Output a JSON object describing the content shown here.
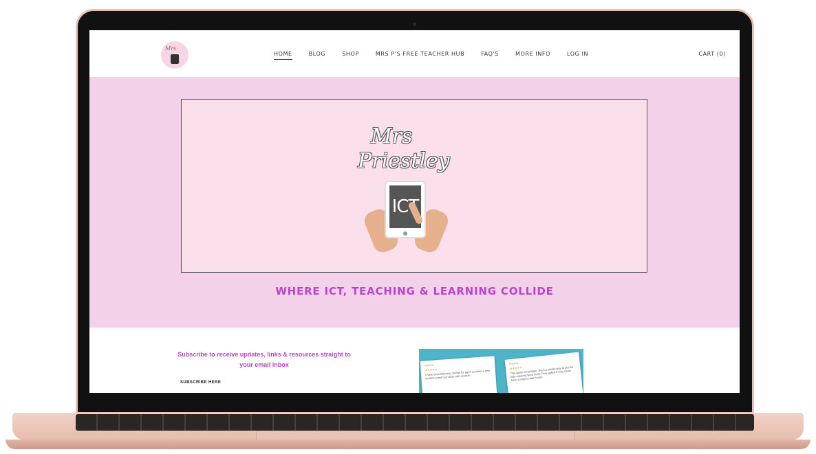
{
  "nav": {
    "items": [
      {
        "label": "HOME",
        "active": true
      },
      {
        "label": "BLOG",
        "active": false
      },
      {
        "label": "SHOP",
        "active": false
      },
      {
        "label": "MRS P'S FREE TEACHER HUB",
        "active": false
      },
      {
        "label": "FAQ'S",
        "active": false
      },
      {
        "label": "MORE INFO",
        "active": false
      },
      {
        "label": "LOG IN",
        "active": false
      }
    ],
    "cart": "CART (0)"
  },
  "hero": {
    "brand_line1": "Mrs",
    "brand_line2": "Priestley",
    "tablet_text": "ICT",
    "tagline": "WHERE ICT, TEACHING & LEARNING COLLIDE",
    "background": "#f3d1e8",
    "accent": "#b846c8"
  },
  "subscribe": {
    "text": "Subscribe to receive updates, links & resources straight to your email inbox",
    "label": "SUBSCRIBE HERE"
  },
  "reviews": {
    "background": "#4fb3c9",
    "cards": [
      {
        "title": "Review",
        "stars": "★★★★★",
        "text": "I have been following Jordan for ages so when a new student joined our class with several..."
      },
      {
        "title": "Review",
        "stars": "★★★★★",
        "text": "This game is fantastic. Such a simple way to get the kids enjoying word work! They asked if they could have a copy to take home."
      }
    ]
  }
}
